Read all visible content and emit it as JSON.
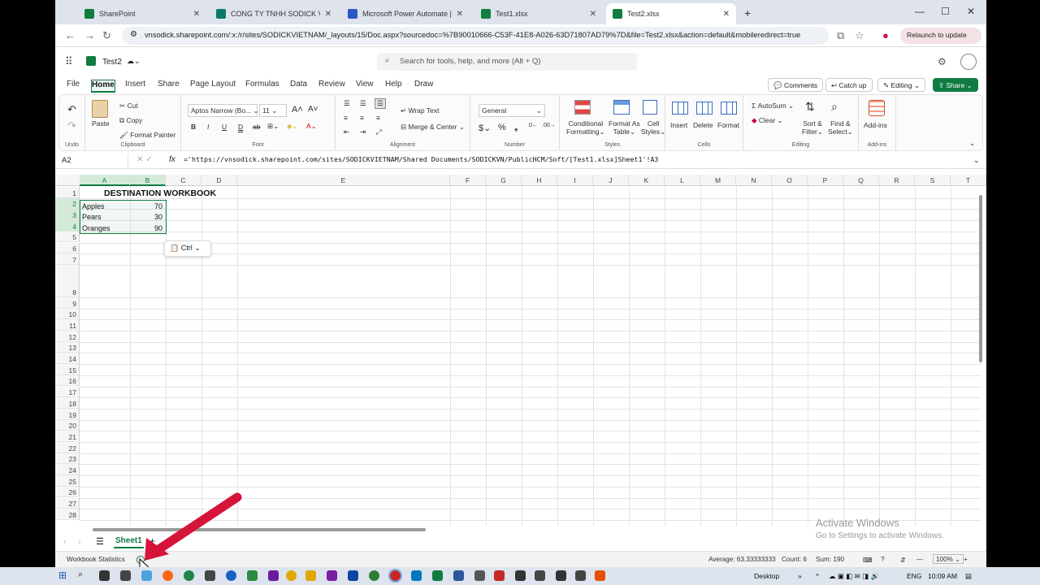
{
  "browser": {
    "tabs": [
      {
        "title": "SharePoint",
        "color": "#107c41"
      },
      {
        "title": "CONG TY TNHH SODICK VIET N",
        "color": "#0b7a6b"
      },
      {
        "title": "Microsoft Power Automate | Da",
        "color": "#2b57c9"
      },
      {
        "title": "Test1.xlsx",
        "color": "#107c41"
      },
      {
        "title": "Test2.xlsx",
        "color": "#107c41"
      }
    ],
    "url": "vnsodick.sharepoint.com/:x:/r/sites/SODICKVIETNAM/_layouts/15/Doc.aspx?sourcedoc=%7B90010666-C53F-41E8-A026-63D71807AD79%7D&file=Test2.xlsx&action=default&mobileredirect=true",
    "relaunch": "Relaunch to update"
  },
  "app": {
    "doc_title": "Test2",
    "search_placeholder": "Search for tools, help, and more (Alt + Q)"
  },
  "ribbon_tabs": [
    "File",
    "Home",
    "Insert",
    "Share",
    "Page Layout",
    "Formulas",
    "Data",
    "Review",
    "View",
    "Help",
    "Draw"
  ],
  "top_buttons": {
    "comments": "Comments",
    "catchup": "Catch up",
    "editing": "Editing",
    "share": "Share"
  },
  "ribbon": {
    "undo_label": "Undo",
    "paste": "Paste",
    "cut": "Cut",
    "copy": "Copy",
    "format_painter": "Format Painter",
    "clipboard_label": "Clipboard",
    "font_name": "Aptos Narrow (Bo...",
    "font_size": "11",
    "font_label": "Font",
    "wrap_text": "Wrap Text",
    "merge_center": "Merge & Center",
    "alignment_label": "Alignment",
    "number_format": "General",
    "number_label": "Number",
    "cond_fmt_1": "Conditional",
    "cond_fmt_2": "Formatting",
    "fmt_table_1": "Format As",
    "fmt_table_2": "Table",
    "cell_styles_1": "Cell",
    "cell_styles_2": "Styles",
    "styles_label": "Styles",
    "insert": "Insert",
    "delete": "Delete",
    "format": "Format",
    "cells_label": "Cells",
    "autosum": "AutoSum",
    "clear": "Clear",
    "sort_1": "Sort &",
    "sort_2": "Filter",
    "find_1": "Find &",
    "find_2": "Select",
    "editing_label": "Editing",
    "addins": "Add-ins",
    "addins_label": "Add-ins"
  },
  "formula_bar": {
    "name_box": "A2",
    "formula": "='https://vnsodick.sharepoint.com/sites/SODICKVIETNAM/Shared Documents/SODICKVN/PublicHCM/Soft/[Test1.xlsx]Sheet1'!A3"
  },
  "columns": [
    "A",
    "B",
    "C",
    "D",
    "E",
    "F",
    "G",
    "H",
    "I",
    "J",
    "K",
    "L",
    "M",
    "N",
    "O",
    "P",
    "Q",
    "R",
    "S",
    "T"
  ],
  "rows": [
    "1",
    "2",
    "3",
    "4",
    "5",
    "6",
    "7",
    "8",
    "9",
    "10",
    "11",
    "12",
    "13",
    "14",
    "15",
    "16",
    "17",
    "18",
    "19",
    "20",
    "21",
    "22",
    "23",
    "24",
    "25",
    "26",
    "27",
    "28"
  ],
  "sheet": {
    "title": "DESTINATION WORKBOOK",
    "data": [
      {
        "name": "Apples",
        "value": "70"
      },
      {
        "name": "Pears",
        "value": "30"
      },
      {
        "name": "Oranges",
        "value": "90"
      }
    ],
    "paste_options": "Ctrl"
  },
  "sheet_tab": "Sheet1",
  "status": {
    "workbook_stats": "Workbook Statistics",
    "average": "Average: 63.33333333",
    "count": "Count: 6",
    "sum": "Sum: 190",
    "zoom": "100%"
  },
  "watermark": {
    "line1": "Activate Windows",
    "line2": "Go to Settings to activate Windows."
  },
  "taskbar": {
    "desktop": "Desktop",
    "lang": "ENG",
    "time": "10:09 AM"
  },
  "colors": {
    "excel_green": "#107c41",
    "annotation_arrow": "#d6143a"
  }
}
